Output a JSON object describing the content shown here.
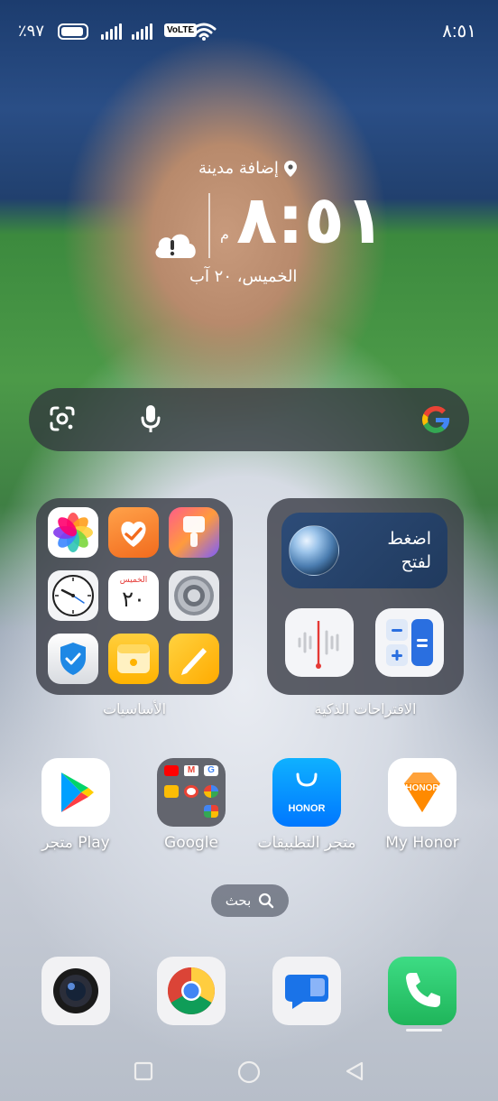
{
  "status_bar": {
    "battery_text": "٪٩٧",
    "time": "٨:٥١",
    "volte": "VoLTE"
  },
  "clock_widget": {
    "location": "إضافة مدينة",
    "time": "٨:٥١",
    "ampm": "م",
    "date": "الخميس، ٢٠ آب",
    "weather_icon": "cloud-alert-icon"
  },
  "search_bar": {
    "lens_icon": "google-lens-icon",
    "mic_icon": "microphone-icon",
    "logo_icon": "google-g-icon"
  },
  "folders": {
    "essentials": {
      "label": "الأساسيات",
      "apps": [
        "gallery",
        "health",
        "themes",
        "clock",
        "calendar",
        "settings",
        "security",
        "notes-memo",
        "notes-pen"
      ],
      "calendar_day": "الخميس",
      "calendar_date": "٢٠"
    },
    "smart_suggestions": {
      "label": "الاقتراحات الذكية",
      "card_text_line1": "اضغط",
      "card_text_line2": "لفتح",
      "apps": [
        "voice-recorder",
        "calculator"
      ]
    }
  },
  "apps_row": [
    {
      "label": "متجر Play",
      "icon": "play-store-icon"
    },
    {
      "label": "Google",
      "icon": "google-folder-icon"
    },
    {
      "label": "متجر التطبيقات",
      "icon": "honor-appgallery-icon"
    },
    {
      "label": "My Honor",
      "icon": "my-honor-icon",
      "badge": "HONOR"
    }
  ],
  "app_store_badge": "HONOR",
  "mini_search": {
    "label": "بحث"
  },
  "dock": [
    {
      "name": "camera",
      "icon": "camera-icon"
    },
    {
      "name": "chrome",
      "icon": "chrome-icon"
    },
    {
      "name": "messages",
      "icon": "messages-icon"
    },
    {
      "name": "phone",
      "icon": "phone-icon"
    }
  ]
}
